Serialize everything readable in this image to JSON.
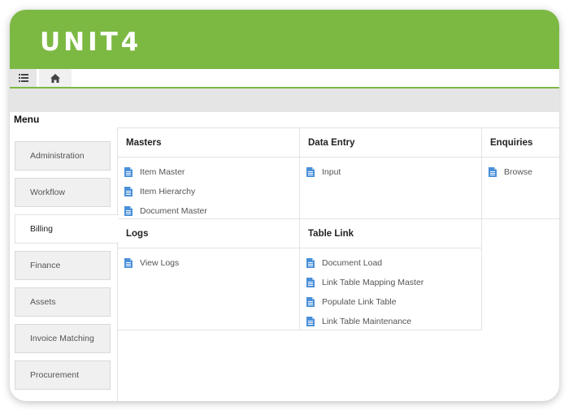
{
  "app": {
    "logo_text": "UNIT4"
  },
  "colors": {
    "brand_green": "#7cb943",
    "icon_blue": "#4a90d9"
  },
  "tabs": [
    {
      "icon": "list-icon"
    },
    {
      "icon": "home-icon"
    }
  ],
  "menu": {
    "title": "Menu"
  },
  "sidebar": {
    "items": [
      {
        "label": "Administration"
      },
      {
        "label": "Workflow"
      },
      {
        "label": "Billing",
        "active": true
      },
      {
        "label": "Finance"
      },
      {
        "label": "Assets"
      },
      {
        "label": "Invoice Matching"
      },
      {
        "label": "Procurement"
      }
    ]
  },
  "panels": {
    "masters": {
      "title": "Masters",
      "items": [
        "Item Master",
        "Item Hierarchy",
        "Document Master"
      ]
    },
    "data_entry": {
      "title": "Data Entry",
      "items": [
        "Input"
      ]
    },
    "enquiries": {
      "title": "Enquiries",
      "items": [
        "Browse"
      ]
    },
    "logs": {
      "title": "Logs",
      "items": [
        "View Logs"
      ]
    },
    "table_link": {
      "title": "Table Link",
      "items": [
        "Document Load",
        "Link Table Mapping Master",
        "Populate Link Table",
        "Link Table Maintenance"
      ]
    }
  }
}
